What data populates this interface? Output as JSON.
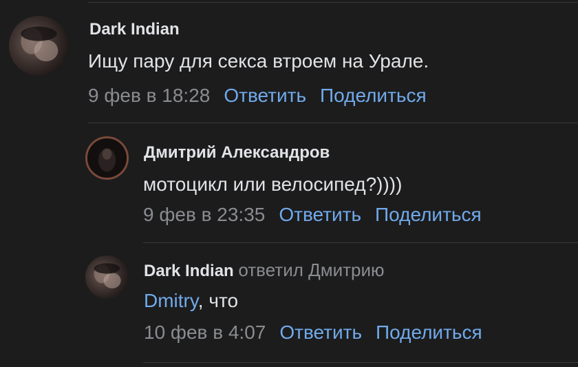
{
  "comments": [
    {
      "author": "Dark Indian",
      "text": "Ищу пару для секса втроем на Урале.",
      "date": "9 фев в 18:28",
      "reply_label": "Ответить",
      "share_label": "Поделиться"
    },
    {
      "author": "Дмитрий Александров",
      "text": "мотоцикл или велосипед?))))",
      "date": "9 фев в 23:35",
      "reply_label": "Ответить",
      "share_label": "Поделиться"
    },
    {
      "author": "Dark Indian",
      "reply_to": "ответил Дмитрию",
      "mention": "Dmitry",
      "text": ", что",
      "date": "10 фев в 4:07",
      "reply_label": "Ответить",
      "share_label": "Поделиться"
    }
  ],
  "colors": {
    "background": "#1c1c1d",
    "text": "#e1e3e6",
    "secondary": "#8a8c90",
    "link": "#71aaeb",
    "divider": "#3a3a3c"
  },
  "icons": [
    "avatar-dark-indian",
    "avatar-dmitry",
    "avatar-dark-indian-reply"
  ]
}
